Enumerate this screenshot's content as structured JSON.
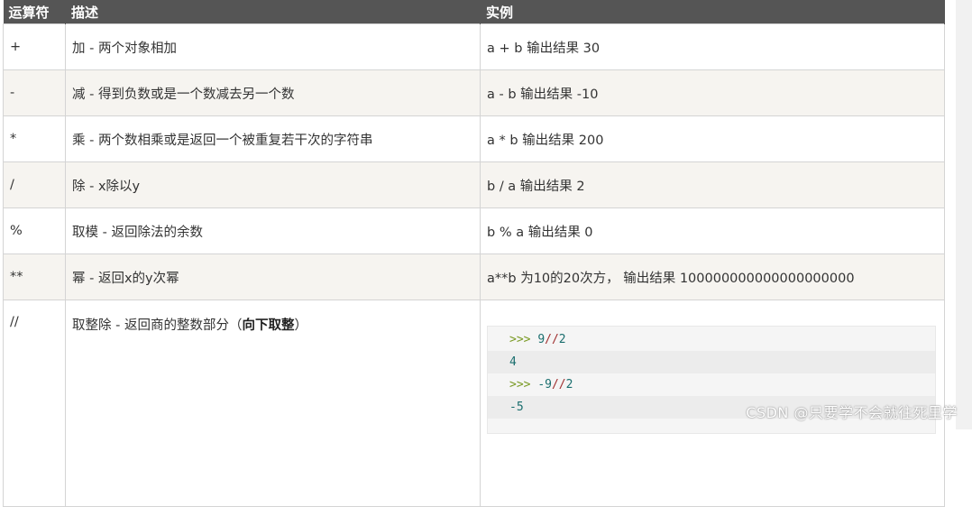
{
  "table": {
    "headers": {
      "operator": "运算符",
      "description": "描述",
      "example": "实例"
    },
    "rows": [
      {
        "operator": "+",
        "description": "加 - 两个对象相加",
        "example": "a + b 输出结果 30"
      },
      {
        "operator": "-",
        "description": "减 - 得到负数或是一个数减去另一个数",
        "example": "a - b 输出结果 -10"
      },
      {
        "operator": "*",
        "description": "乘 - 两个数相乘或是返回一个被重复若干次的字符串",
        "example": "a * b 输出结果 200"
      },
      {
        "operator": "/",
        "description": "除 - x除以y",
        "example": "b / a 输出结果 2"
      },
      {
        "operator": "%",
        "description": "取模 - 返回除法的余数",
        "example": "b % a 输出结果 0"
      },
      {
        "operator": "**",
        "description": "幂 - 返回x的y次幂",
        "example": "a**b 为10的20次方， 输出结果 100000000000000000000"
      }
    ],
    "floor_row": {
      "operator": "//",
      "description_prefix": "取整除 - 返回商的整数部分（",
      "description_bold": "向下取整",
      "description_suffix": "）",
      "code_lines": [
        {
          "prompt": ">>> ",
          "left": "9",
          "op": "//",
          "right": "2"
        },
        {
          "output": "4"
        },
        {
          "prompt": ">>> ",
          "left": "-9",
          "op": "//",
          "right": "2"
        },
        {
          "output": "-5"
        }
      ]
    }
  },
  "watermark": "CSDN @只要学不会就往死里学"
}
